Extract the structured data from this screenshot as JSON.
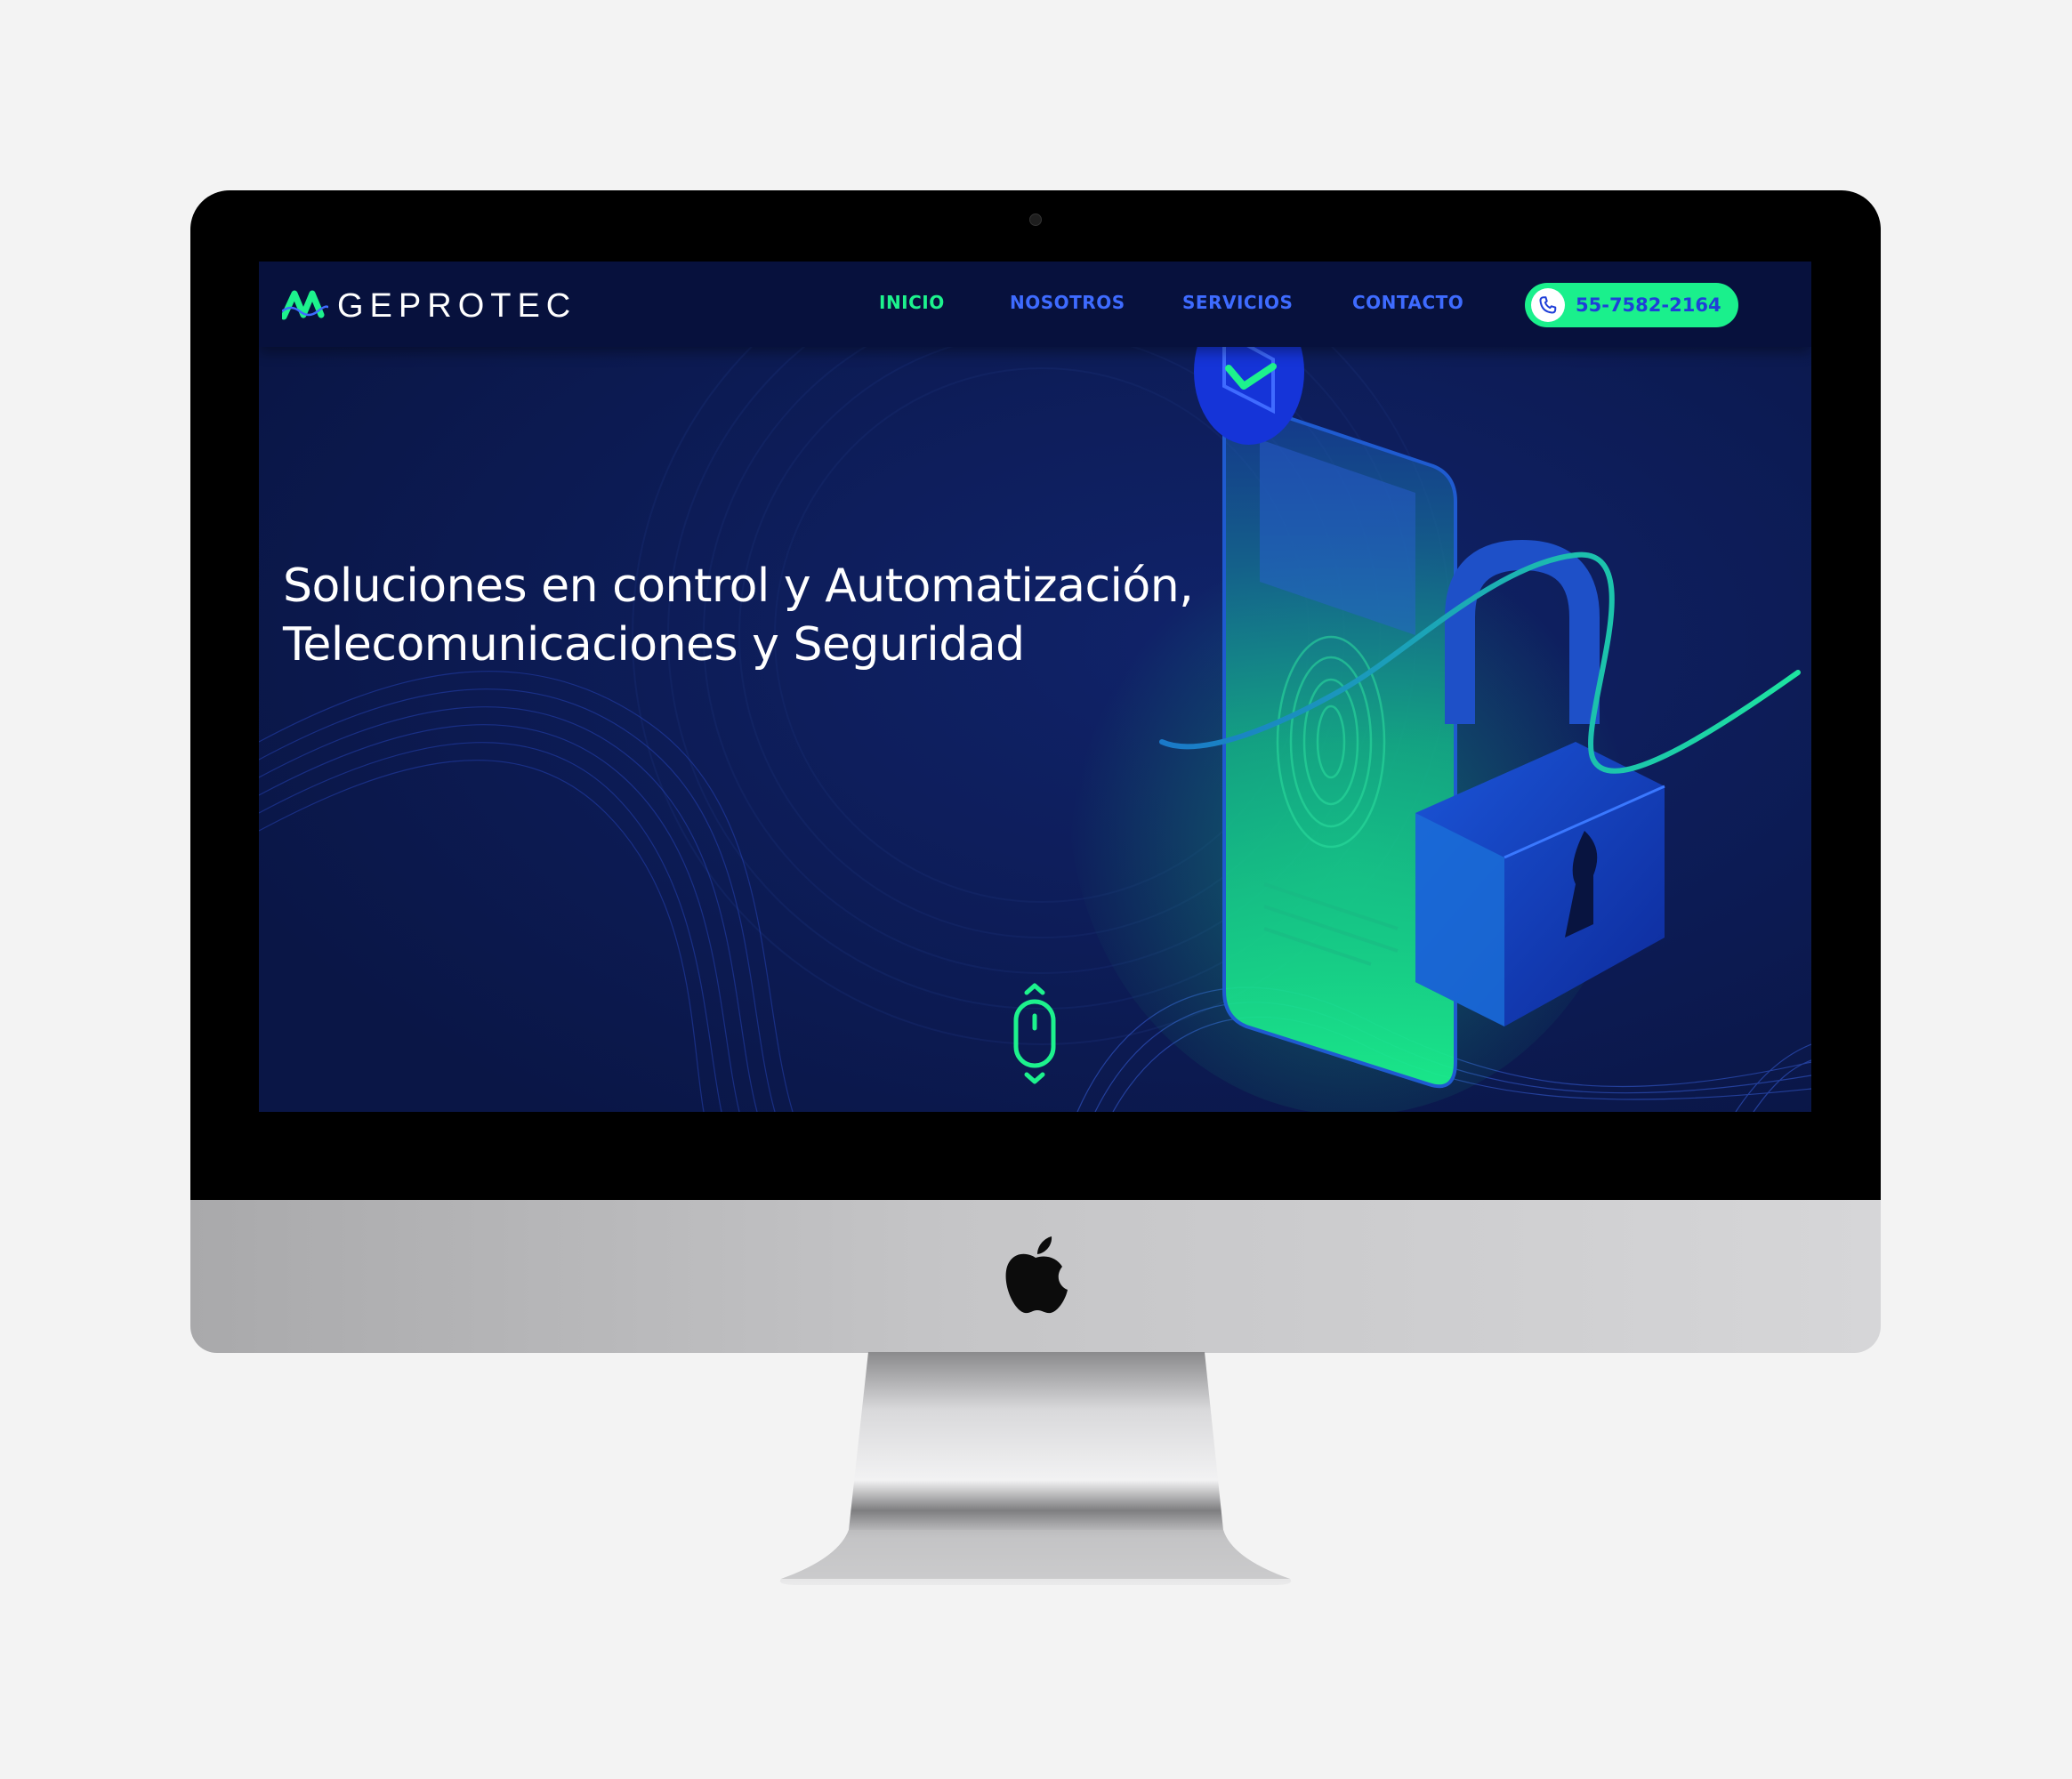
{
  "site": {
    "logo_text": "GEPROTEC",
    "nav": [
      {
        "label": "INICIO",
        "active": true
      },
      {
        "label": "NOSOTROS",
        "active": false
      },
      {
        "label": "SERVICIOS",
        "active": false
      },
      {
        "label": "CONTACTO",
        "active": false
      }
    ],
    "phone": "55-7582-2164",
    "hero": {
      "line1": "Soluciones en control y Automatización,",
      "line2": "Telecomunicaciones y Seguridad"
    }
  },
  "colors": {
    "background": "#0b1a4f",
    "topbar": "#07113d",
    "accent_green": "#1df28d",
    "nav_blue": "#3e6bff",
    "phone_text": "#1f3fd8"
  },
  "icons": [
    "logo-wave-icon",
    "phone-icon",
    "checkmark-icon",
    "padlock-icon",
    "fingerprint-icon",
    "mouse-scroll-icon",
    "apple-logo-icon"
  ]
}
